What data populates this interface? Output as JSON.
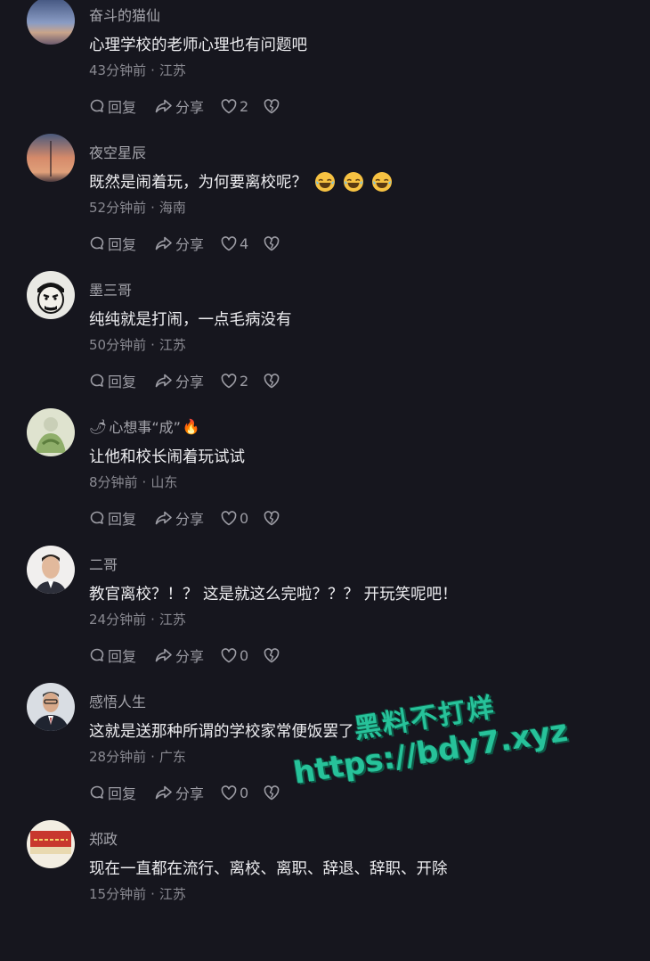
{
  "comments": [
    {
      "username": "奋斗的猫仙",
      "text": "心理学校的老师心理也有问题吧",
      "time": "43分钟前",
      "location": "江苏",
      "reply": "回复",
      "share": "分享",
      "likes": "2"
    },
    {
      "username": "夜空星辰",
      "text": "既然是闹着玩，为何要离校呢？",
      "time": "52分钟前",
      "location": "海南",
      "reply": "回复",
      "share": "分享",
      "likes": "4"
    },
    {
      "username": "墨三哥",
      "text": "纯纯就是打闹，一点毛病没有",
      "time": "50分钟前",
      "location": "江苏",
      "reply": "回复",
      "share": "分享",
      "likes": "2"
    },
    {
      "username": "心想事“成”",
      "text": "让他和校长闹着玩试试",
      "time": "8分钟前",
      "location": "山东",
      "reply": "回复",
      "share": "分享",
      "likes": "0"
    },
    {
      "username": "二哥",
      "text": "教官离校？！？ 这是就这么完啦？？？ 开玩笑呢吧！",
      "time": "24分钟前",
      "location": "江苏",
      "reply": "回复",
      "share": "分享",
      "likes": "0"
    },
    {
      "username": "感悟人生",
      "text": "这就是送那种所谓的学校家常便饭罢了",
      "time": "28分钟前",
      "location": "广东",
      "reply": "回复",
      "share": "分享",
      "likes": "0"
    },
    {
      "username": "郑政",
      "text": "现在一直都在流行、离校、离职、辞退、辞职、开除",
      "time": "15分钟前",
      "location": "江苏"
    }
  ],
  "username_emoji": {
    "chili": "🌶",
    "fire": "🔥"
  },
  "watermark": {
    "line1": "黑料不打烊",
    "line2": "https://bdy7.xyz"
  }
}
